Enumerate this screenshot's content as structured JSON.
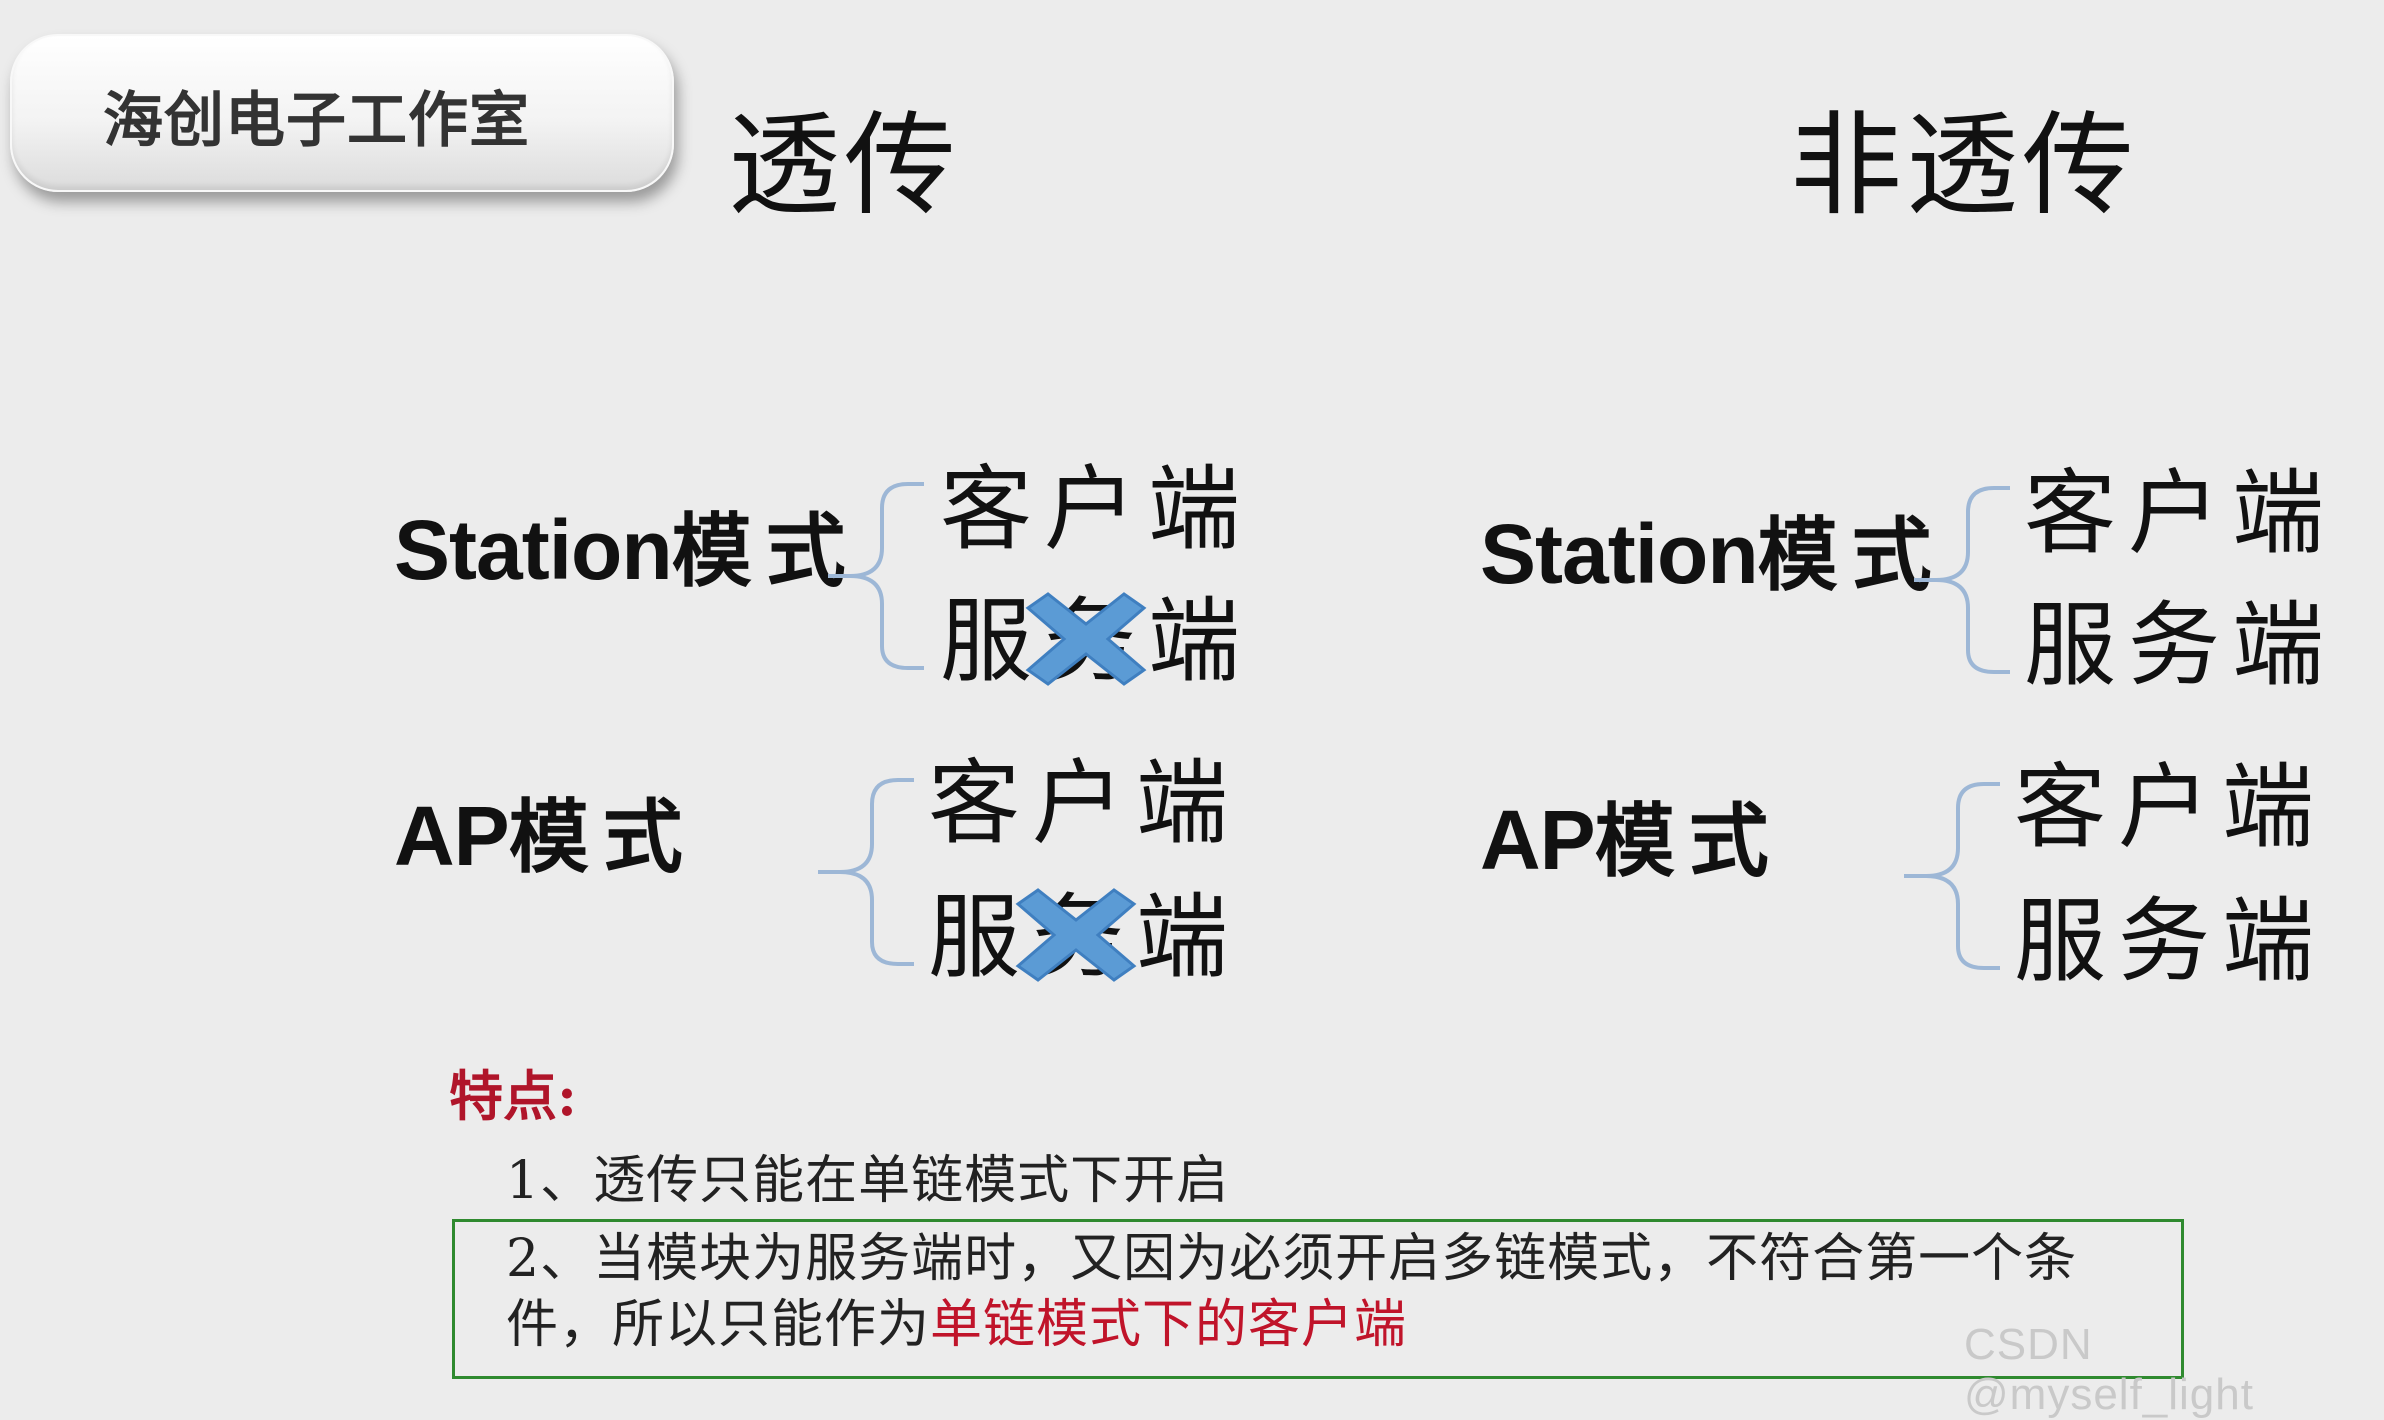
{
  "badge": {
    "text": "海创电子工作室"
  },
  "left": {
    "title": "透传",
    "station": {
      "mode_en": "Station",
      "mode_cn": "模式",
      "client": "客户端",
      "server": "服务端",
      "server_disabled": true
    },
    "ap": {
      "mode_en": "AP",
      "mode_cn": "模式",
      "client": "客户端",
      "server": "服务端",
      "server_disabled": true
    }
  },
  "right": {
    "title": "非透传",
    "station": {
      "mode_en": "Station",
      "mode_cn": "模式",
      "client": "客户端",
      "server": "服务端",
      "server_disabled": false
    },
    "ap": {
      "mode_en": "AP",
      "mode_cn": "模式",
      "client": "客户端",
      "server": "服务端",
      "server_disabled": false
    }
  },
  "features": {
    "label": "特点:",
    "point1": "1、透传只能在单链模式下开启",
    "point2_line1": "2、当模块为服务端时，又因为必须开启多链模式，不符合第一个条",
    "point2_line2_prefix": "件，所以只能作为",
    "point2_line2_highlight": "单链模式下的客户端"
  },
  "watermark": "CSDN @myself_light",
  "colors": {
    "background": "#ececec",
    "brace": "#9db7d6",
    "x_mark": "#5b9bd5",
    "highlight_red": "#c0142a",
    "box_green": "#2f8a2f"
  },
  "icons": {
    "disabled_marker": "x-mark-icon"
  }
}
